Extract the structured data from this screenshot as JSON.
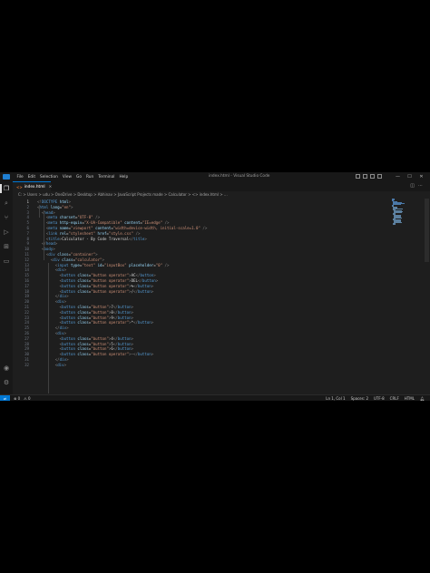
{
  "window": {
    "title": "index.html - Visual Studio Code",
    "menu": [
      "File",
      "Edit",
      "Selection",
      "View",
      "Go",
      "Run",
      "Terminal",
      "Help"
    ],
    "controls": [
      "—",
      "☐",
      "✕"
    ]
  },
  "tab": {
    "label": "index.html",
    "icon": "<>",
    "close": "×"
  },
  "breadcrumb": "C: > Users > udu > OneDrive > Desktop > Abhinav > JavaScript Projects made > Calculator > <> index.html > ...",
  "code_lines": [
    [
      {
        "c": "t",
        "v": "<!"
      },
      {
        "c": "tag",
        "v": "DOCTYPE"
      },
      {
        "c": "attr",
        "v": " html"
      },
      {
        "c": "t",
        "v": ">"
      }
    ],
    [
      {
        "c": "t",
        "v": "<"
      },
      {
        "c": "tag",
        "v": "html"
      },
      {
        "c": "attr",
        "v": " lang"
      },
      {
        "c": "txt",
        "v": "="
      },
      {
        "c": "str",
        "v": "\"en\""
      },
      {
        "c": "t",
        "v": ">"
      }
    ],
    [
      {
        "c": "txt",
        "v": "  "
      },
      {
        "c": "t",
        "v": "<"
      },
      {
        "c": "tag",
        "v": "head"
      },
      {
        "c": "t",
        "v": ">"
      }
    ],
    [
      {
        "c": "txt",
        "v": "    "
      },
      {
        "c": "t",
        "v": "<"
      },
      {
        "c": "tag",
        "v": "meta"
      },
      {
        "c": "attr",
        "v": " charset"
      },
      {
        "c": "txt",
        "v": "="
      },
      {
        "c": "str",
        "v": "\"UTF-8\""
      },
      {
        "c": "t",
        "v": " />"
      }
    ],
    [
      {
        "c": "txt",
        "v": "    "
      },
      {
        "c": "t",
        "v": "<"
      },
      {
        "c": "tag",
        "v": "meta"
      },
      {
        "c": "attr",
        "v": " http-equiv"
      },
      {
        "c": "txt",
        "v": "="
      },
      {
        "c": "str",
        "v": "\"X-UA-Compatible\""
      },
      {
        "c": "attr",
        "v": " content"
      },
      {
        "c": "txt",
        "v": "="
      },
      {
        "c": "str",
        "v": "\"IE=edge\""
      },
      {
        "c": "t",
        "v": " />"
      }
    ],
    [
      {
        "c": "txt",
        "v": "    "
      },
      {
        "c": "t",
        "v": "<"
      },
      {
        "c": "tag",
        "v": "meta"
      },
      {
        "c": "attr",
        "v": " name"
      },
      {
        "c": "txt",
        "v": "="
      },
      {
        "c": "str",
        "v": "\"viewport\""
      },
      {
        "c": "attr",
        "v": " content"
      },
      {
        "c": "txt",
        "v": "="
      },
      {
        "c": "str",
        "v": "\"width=device-width, initial-scale=1.0\""
      },
      {
        "c": "t",
        "v": " />"
      }
    ],
    [
      {
        "c": "txt",
        "v": "    "
      },
      {
        "c": "t",
        "v": "<"
      },
      {
        "c": "tag",
        "v": "link"
      },
      {
        "c": "attr",
        "v": " rel"
      },
      {
        "c": "txt",
        "v": "="
      },
      {
        "c": "str",
        "v": "\"stylesheet\""
      },
      {
        "c": "attr",
        "v": " href"
      },
      {
        "c": "txt",
        "v": "="
      },
      {
        "c": "str",
        "v": "\"style.css\""
      },
      {
        "c": "t",
        "v": " />"
      }
    ],
    [
      {
        "c": "txt",
        "v": "    "
      },
      {
        "c": "t",
        "v": "<"
      },
      {
        "c": "tag",
        "v": "title"
      },
      {
        "c": "t",
        "v": ">"
      },
      {
        "c": "txt",
        "v": "Calculator - By Code Traversal"
      },
      {
        "c": "t",
        "v": "</"
      },
      {
        "c": "tag",
        "v": "title"
      },
      {
        "c": "t",
        "v": ">"
      }
    ],
    [
      {
        "c": "txt",
        "v": "  "
      },
      {
        "c": "t",
        "v": "</"
      },
      {
        "c": "tag",
        "v": "head"
      },
      {
        "c": "t",
        "v": ">"
      }
    ],
    [
      {
        "c": "txt",
        "v": "  "
      },
      {
        "c": "t",
        "v": "<"
      },
      {
        "c": "tag",
        "v": "body"
      },
      {
        "c": "t",
        "v": ">"
      }
    ],
    [
      {
        "c": "txt",
        "v": "    "
      },
      {
        "c": "t",
        "v": "<"
      },
      {
        "c": "tag",
        "v": "div"
      },
      {
        "c": "attr",
        "v": " class"
      },
      {
        "c": "txt",
        "v": "="
      },
      {
        "c": "str",
        "v": "\"container\""
      },
      {
        "c": "t",
        "v": ">"
      }
    ],
    [
      {
        "c": "txt",
        "v": "      "
      },
      {
        "c": "t",
        "v": "<"
      },
      {
        "c": "tag",
        "v": "div"
      },
      {
        "c": "attr",
        "v": " class"
      },
      {
        "c": "txt",
        "v": "="
      },
      {
        "c": "str",
        "v": "\"calculator\""
      },
      {
        "c": "t",
        "v": ">"
      }
    ],
    [
      {
        "c": "txt",
        "v": "        "
      },
      {
        "c": "t",
        "v": "<"
      },
      {
        "c": "tag",
        "v": "input"
      },
      {
        "c": "attr",
        "v": " type"
      },
      {
        "c": "txt",
        "v": "="
      },
      {
        "c": "str",
        "v": "\"text\""
      },
      {
        "c": "attr",
        "v": " id"
      },
      {
        "c": "txt",
        "v": "="
      },
      {
        "c": "str",
        "v": "\"inputBox\""
      },
      {
        "c": "attr",
        "v": " placeholder"
      },
      {
        "c": "txt",
        "v": "="
      },
      {
        "c": "str",
        "v": "\"0\""
      },
      {
        "c": "t",
        "v": " />"
      }
    ],
    [
      {
        "c": "txt",
        "v": "        "
      },
      {
        "c": "t",
        "v": "<"
      },
      {
        "c": "tag",
        "v": "div"
      },
      {
        "c": "t",
        "v": ">"
      }
    ],
    [
      {
        "c": "txt",
        "v": "          "
      },
      {
        "c": "t",
        "v": "<"
      },
      {
        "c": "tag",
        "v": "button"
      },
      {
        "c": "attr",
        "v": " class"
      },
      {
        "c": "txt",
        "v": "="
      },
      {
        "c": "str",
        "v": "\"button operator\""
      },
      {
        "c": "t",
        "v": ">"
      },
      {
        "c": "txt",
        "v": "AC"
      },
      {
        "c": "t",
        "v": "</"
      },
      {
        "c": "tag",
        "v": "button"
      },
      {
        "c": "t",
        "v": ">"
      }
    ],
    [
      {
        "c": "txt",
        "v": "          "
      },
      {
        "c": "t",
        "v": "<"
      },
      {
        "c": "tag",
        "v": "button"
      },
      {
        "c": "attr",
        "v": " class"
      },
      {
        "c": "txt",
        "v": "="
      },
      {
        "c": "str",
        "v": "\"button operator\""
      },
      {
        "c": "t",
        "v": ">"
      },
      {
        "c": "txt",
        "v": "DEL"
      },
      {
        "c": "t",
        "v": "</"
      },
      {
        "c": "tag",
        "v": "button"
      },
      {
        "c": "t",
        "v": ">"
      }
    ],
    [
      {
        "c": "txt",
        "v": "          "
      },
      {
        "c": "t",
        "v": "<"
      },
      {
        "c": "tag",
        "v": "button"
      },
      {
        "c": "attr",
        "v": " class"
      },
      {
        "c": "txt",
        "v": "="
      },
      {
        "c": "str",
        "v": "\"button operator\""
      },
      {
        "c": "t",
        "v": ">"
      },
      {
        "c": "txt",
        "v": "%"
      },
      {
        "c": "t",
        "v": "</"
      },
      {
        "c": "tag",
        "v": "button"
      },
      {
        "c": "t",
        "v": ">"
      }
    ],
    [
      {
        "c": "txt",
        "v": "          "
      },
      {
        "c": "t",
        "v": "<"
      },
      {
        "c": "tag",
        "v": "button"
      },
      {
        "c": "attr",
        "v": " class"
      },
      {
        "c": "txt",
        "v": "="
      },
      {
        "c": "str",
        "v": "\"button operator\""
      },
      {
        "c": "t",
        "v": ">"
      },
      {
        "c": "txt",
        "v": "/"
      },
      {
        "c": "t",
        "v": "</"
      },
      {
        "c": "tag",
        "v": "button"
      },
      {
        "c": "t",
        "v": ">"
      }
    ],
    [
      {
        "c": "txt",
        "v": "        "
      },
      {
        "c": "t",
        "v": "</"
      },
      {
        "c": "tag",
        "v": "div"
      },
      {
        "c": "t",
        "v": ">"
      }
    ],
    [
      {
        "c": "txt",
        "v": "        "
      },
      {
        "c": "t",
        "v": "<"
      },
      {
        "c": "tag",
        "v": "div"
      },
      {
        "c": "t",
        "v": ">"
      }
    ],
    [
      {
        "c": "txt",
        "v": "          "
      },
      {
        "c": "t",
        "v": "<"
      },
      {
        "c": "tag",
        "v": "button"
      },
      {
        "c": "attr",
        "v": " class"
      },
      {
        "c": "txt",
        "v": "="
      },
      {
        "c": "str",
        "v": "\"button\""
      },
      {
        "c": "t",
        "v": ">"
      },
      {
        "c": "txt",
        "v": "7"
      },
      {
        "c": "t",
        "v": "</"
      },
      {
        "c": "tag",
        "v": "button"
      },
      {
        "c": "t",
        "v": ">"
      }
    ],
    [
      {
        "c": "txt",
        "v": "          "
      },
      {
        "c": "t",
        "v": "<"
      },
      {
        "c": "tag",
        "v": "button"
      },
      {
        "c": "attr",
        "v": " class"
      },
      {
        "c": "txt",
        "v": "="
      },
      {
        "c": "str",
        "v": "\"button\""
      },
      {
        "c": "t",
        "v": ">"
      },
      {
        "c": "txt",
        "v": "8"
      },
      {
        "c": "t",
        "v": "</"
      },
      {
        "c": "tag",
        "v": "button"
      },
      {
        "c": "t",
        "v": ">"
      }
    ],
    [
      {
        "c": "txt",
        "v": "          "
      },
      {
        "c": "t",
        "v": "<"
      },
      {
        "c": "tag",
        "v": "button"
      },
      {
        "c": "attr",
        "v": " class"
      },
      {
        "c": "txt",
        "v": "="
      },
      {
        "c": "str",
        "v": "\"button\""
      },
      {
        "c": "t",
        "v": ">"
      },
      {
        "c": "txt",
        "v": "9"
      },
      {
        "c": "t",
        "v": "</"
      },
      {
        "c": "tag",
        "v": "button"
      },
      {
        "c": "t",
        "v": ">"
      }
    ],
    [
      {
        "c": "txt",
        "v": "          "
      },
      {
        "c": "t",
        "v": "<"
      },
      {
        "c": "tag",
        "v": "button"
      },
      {
        "c": "attr",
        "v": " class"
      },
      {
        "c": "txt",
        "v": "="
      },
      {
        "c": "str",
        "v": "\"button operator\""
      },
      {
        "c": "t",
        "v": ">"
      },
      {
        "c": "txt",
        "v": "*"
      },
      {
        "c": "t",
        "v": "</"
      },
      {
        "c": "tag",
        "v": "button"
      },
      {
        "c": "t",
        "v": ">"
      }
    ],
    [
      {
        "c": "txt",
        "v": "        "
      },
      {
        "c": "t",
        "v": "</"
      },
      {
        "c": "tag",
        "v": "div"
      },
      {
        "c": "t",
        "v": ">"
      }
    ],
    [
      {
        "c": "txt",
        "v": "        "
      },
      {
        "c": "t",
        "v": "<"
      },
      {
        "c": "tag",
        "v": "div"
      },
      {
        "c": "t",
        "v": ">"
      }
    ],
    [
      {
        "c": "txt",
        "v": "          "
      },
      {
        "c": "t",
        "v": "<"
      },
      {
        "c": "tag",
        "v": "button"
      },
      {
        "c": "attr",
        "v": " class"
      },
      {
        "c": "txt",
        "v": "="
      },
      {
        "c": "str",
        "v": "\"button\""
      },
      {
        "c": "t",
        "v": ">"
      },
      {
        "c": "txt",
        "v": "4"
      },
      {
        "c": "t",
        "v": "</"
      },
      {
        "c": "tag",
        "v": "button"
      },
      {
        "c": "t",
        "v": ">"
      }
    ],
    [
      {
        "c": "txt",
        "v": "          "
      },
      {
        "c": "t",
        "v": "<"
      },
      {
        "c": "tag",
        "v": "button"
      },
      {
        "c": "attr",
        "v": " class"
      },
      {
        "c": "txt",
        "v": "="
      },
      {
        "c": "str",
        "v": "\"button\""
      },
      {
        "c": "t",
        "v": ">"
      },
      {
        "c": "txt",
        "v": "5"
      },
      {
        "c": "t",
        "v": "</"
      },
      {
        "c": "tag",
        "v": "button"
      },
      {
        "c": "t",
        "v": ">"
      }
    ],
    [
      {
        "c": "txt",
        "v": "          "
      },
      {
        "c": "t",
        "v": "<"
      },
      {
        "c": "tag",
        "v": "button"
      },
      {
        "c": "attr",
        "v": " class"
      },
      {
        "c": "txt",
        "v": "="
      },
      {
        "c": "str",
        "v": "\"button\""
      },
      {
        "c": "t",
        "v": ">"
      },
      {
        "c": "txt",
        "v": "6"
      },
      {
        "c": "t",
        "v": "</"
      },
      {
        "c": "tag",
        "v": "button"
      },
      {
        "c": "t",
        "v": ">"
      }
    ],
    [
      {
        "c": "txt",
        "v": "          "
      },
      {
        "c": "t",
        "v": "<"
      },
      {
        "c": "tag",
        "v": "button"
      },
      {
        "c": "attr",
        "v": " class"
      },
      {
        "c": "txt",
        "v": "="
      },
      {
        "c": "str",
        "v": "\"button operator\""
      },
      {
        "c": "t",
        "v": ">"
      },
      {
        "c": "txt",
        "v": "-"
      },
      {
        "c": "t",
        "v": "</"
      },
      {
        "c": "tag",
        "v": "button"
      },
      {
        "c": "t",
        "v": ">"
      }
    ],
    [
      {
        "c": "txt",
        "v": "        "
      },
      {
        "c": "t",
        "v": "</"
      },
      {
        "c": "tag",
        "v": "div"
      },
      {
        "c": "t",
        "v": ">"
      }
    ],
    [
      {
        "c": "txt",
        "v": "        "
      },
      {
        "c": "t",
        "v": "<"
      },
      {
        "c": "tag",
        "v": "div"
      },
      {
        "c": "t",
        "v": ">"
      }
    ]
  ],
  "status": {
    "left": [
      "⊗ 0",
      "⚠ 0"
    ],
    "right": [
      "Ln 1, Col 1",
      "Spaces: 2",
      "UTF-8",
      "CRLF",
      "HTML"
    ]
  },
  "colors": {
    "accent": "#0078d4",
    "tag": "#569cd6",
    "attr": "#9cdcfe",
    "string": "#ce9178"
  },
  "icons": {
    "activity": [
      "files-icon",
      "search-icon",
      "source-control-icon",
      "run-debug-icon",
      "extensions-icon",
      "remote-explorer-icon"
    ],
    "activity_bottom": [
      "account-icon",
      "settings-gear-icon"
    ]
  }
}
